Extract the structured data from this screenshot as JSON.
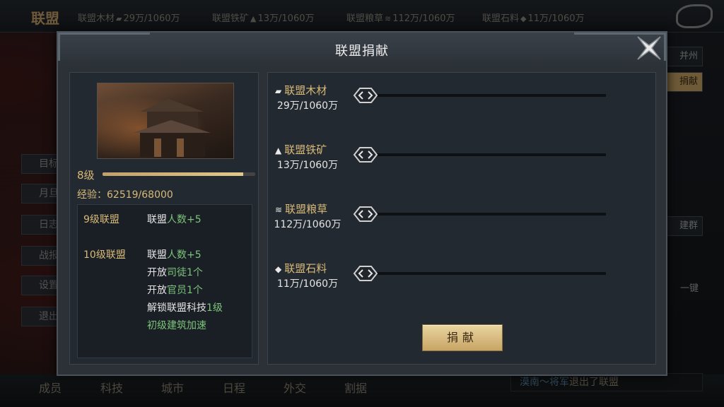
{
  "topbar": {
    "title": "联盟",
    "resources": [
      {
        "label": "联盟木材",
        "icon": "wood-icon",
        "value": "29万/1060万"
      },
      {
        "label": "联盟铁矿",
        "icon": "ore-icon",
        "value": "13万/1060万"
      },
      {
        "label": "联盟粮草",
        "icon": "grain-icon",
        "value": "112万/1060万"
      },
      {
        "label": "联盟石料",
        "icon": "stone-icon",
        "value": "11万/1060万"
      }
    ]
  },
  "side_menu": [
    "目标",
    "月旦",
    "日志",
    "战报",
    "设置",
    "退出"
  ],
  "right_side": {
    "city": "并州",
    "donate": "捐献",
    "group": "建群",
    "one_key": "一键"
  },
  "bottom_tabs": [
    "成员",
    "科技",
    "城市",
    "日程",
    "外交",
    "割据"
  ],
  "feed": {
    "actor": "漠南～将军",
    "text": "退出了联盟"
  },
  "modal": {
    "title": "联盟捐献",
    "level": "8级",
    "xp_fraction": 0.92,
    "xp_text": "经验：62519/68000",
    "benefits": {
      "lv9": {
        "name": "9级联盟",
        "perks": [
          {
            "prefix": "联盟",
            "highlight": "人数+5",
            "suffix": ""
          }
        ]
      },
      "lv10": {
        "name": "10级联盟",
        "perks": [
          {
            "prefix": "联盟",
            "highlight": "人数+5",
            "suffix": ""
          },
          {
            "prefix": "开放",
            "highlight": "司徒1个",
            "suffix": ""
          },
          {
            "prefix": "开放",
            "highlight": "官员1个",
            "suffix": ""
          },
          {
            "prefix": "解锁联盟科技",
            "highlight": "1级",
            "suffix": ""
          },
          {
            "prefix": "",
            "highlight": "初级建筑加速",
            "suffix": ""
          }
        ]
      }
    },
    "resources": [
      {
        "name": "联盟木材",
        "icon": "wood-icon",
        "amount": "29万/1060万"
      },
      {
        "name": "联盟铁矿",
        "icon": "ore-icon",
        "amount": "13万/1060万"
      },
      {
        "name": "联盟粮草",
        "icon": "grain-icon",
        "amount": "112万/1060万"
      },
      {
        "name": "联盟石料",
        "icon": "stone-icon",
        "amount": "11万/1060万"
      }
    ],
    "donate_label": "捐献"
  },
  "colors": {
    "accent_gold": "#d7b978",
    "highlight_green": "#7cc47a",
    "panel_bg": "#232930"
  }
}
